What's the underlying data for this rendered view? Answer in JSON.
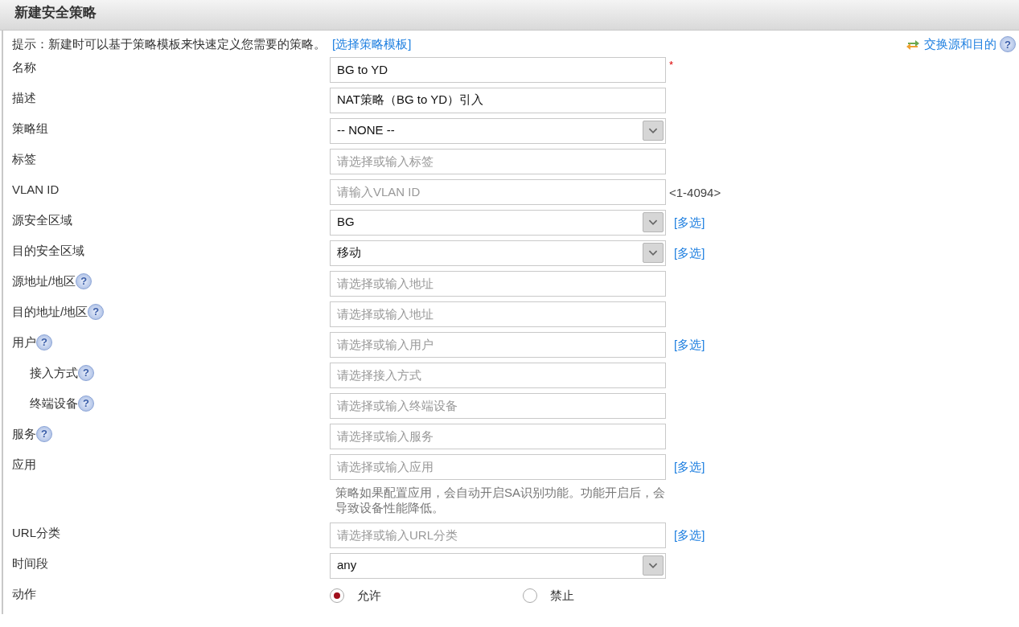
{
  "title": "新建安全策略",
  "hint": {
    "text": "提示：新建时可以基于策略模板来快速定义您需要的策略。",
    "link": "[选择策略模板]"
  },
  "swap": {
    "label": "交换源和目的",
    "help": "?"
  },
  "fields": [
    {
      "label": "名称",
      "kind": "text",
      "value": "BG to YD",
      "required": "*"
    },
    {
      "label": "描述",
      "kind": "text",
      "value": "NAT策略（BG to YD）引入"
    },
    {
      "label": "策略组",
      "kind": "select",
      "value": "-- NONE --"
    },
    {
      "label": "标签",
      "kind": "text",
      "placeholder": "请选择或输入标签"
    },
    {
      "label": "VLAN ID",
      "kind": "text",
      "placeholder": "请输入VLAN ID",
      "suffix": "<1-4094>"
    },
    {
      "label": "源安全区域",
      "kind": "select",
      "value": "BG",
      "link": "[多选]"
    },
    {
      "label": "目的安全区域",
      "kind": "select",
      "value": "移动",
      "link": "[多选]"
    },
    {
      "label": "源地址/地区",
      "help": "?",
      "kind": "text",
      "placeholder": "请选择或输入地址"
    },
    {
      "label": "目的地址/地区",
      "help": "?",
      "kind": "text",
      "placeholder": "请选择或输入地址"
    },
    {
      "label": "用户",
      "help": "?",
      "kind": "text",
      "placeholder": "请选择或输入用户",
      "link": "[多选]",
      "children": [
        {
          "label": "接入方式",
          "help": "?",
          "kind": "text",
          "placeholder": "请选择接入方式"
        },
        {
          "label": "终端设备",
          "help": "?",
          "kind": "text",
          "placeholder": "请选择或输入终端设备"
        }
      ]
    },
    {
      "label": "服务",
      "help": "?",
      "kind": "text",
      "placeholder": "请选择或输入服务"
    },
    {
      "label": "应用",
      "kind": "text",
      "placeholder": "请选择或输入应用",
      "link": "[多选]",
      "note": "策略如果配置应用，会自动开启SA识别功能。功能开启后，会导致设备性能降低。"
    },
    {
      "label": "URL分类",
      "kind": "text",
      "placeholder": "请选择或输入URL分类",
      "link": "[多选]"
    },
    {
      "label": "时间段",
      "kind": "select",
      "value": "any"
    },
    {
      "label": "动作",
      "kind": "radio",
      "options": [
        {
          "label": "允许",
          "selected": true
        },
        {
          "label": "禁止",
          "selected": false
        }
      ]
    }
  ]
}
